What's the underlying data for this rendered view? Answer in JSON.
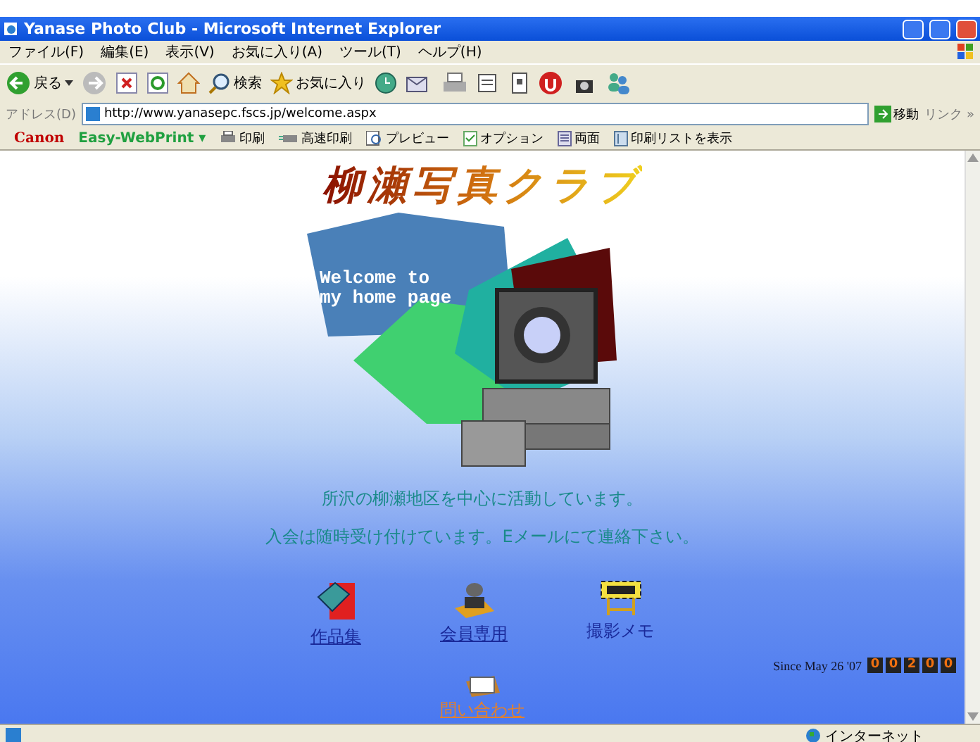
{
  "window": {
    "title": "Yanase Photo Club - Microsoft Internet Explorer"
  },
  "menu": [
    "ファイル(F)",
    "編集(E)",
    "表示(V)",
    "お気に入り(A)",
    "ツール(T)",
    "ヘルプ(H)"
  ],
  "toolbar": {
    "back": "戻る",
    "search": "検索",
    "favorites": "お気に入り"
  },
  "address": {
    "label": "アドレス(D)",
    "value": "http://www.yanasepc.fscs.jp/welcome.aspx",
    "go": "移動",
    "links": "リンク »"
  },
  "print_bar": {
    "brand": "Canon",
    "product": "Easy-WebPrint ▾",
    "buttons": [
      {
        "kind": "print",
        "label": "印刷"
      },
      {
        "kind": "fast",
        "label": "高速印刷"
      },
      {
        "kind": "preview",
        "label": "プレビュー"
      },
      {
        "kind": "options",
        "label": "オプション"
      },
      {
        "kind": "duplex",
        "label": "両面"
      },
      {
        "kind": "list",
        "label": "印刷リストを表示"
      }
    ]
  },
  "page": {
    "heading": "柳瀬写真クラブ",
    "welcome": [
      "Welcome to",
      "my home page"
    ],
    "lines": [
      "所沢の柳瀬地区を中心に活動しています。",
      "入会は随時受け付けています。Eメールにて連絡下さい。"
    ],
    "links": [
      {
        "kind": "book",
        "label": "作品集",
        "link": true
      },
      {
        "kind": "stamp",
        "label": "会員専用",
        "link": true
      },
      {
        "kind": "construction",
        "label": "撮影メモ",
        "link": false
      }
    ],
    "since": "Since May 26 '07",
    "counter": [
      "0",
      "0",
      "2",
      "0",
      "0"
    ],
    "contact": {
      "label": "問い合わせ"
    }
  },
  "status_bar": {
    "zone": "インターネット"
  }
}
